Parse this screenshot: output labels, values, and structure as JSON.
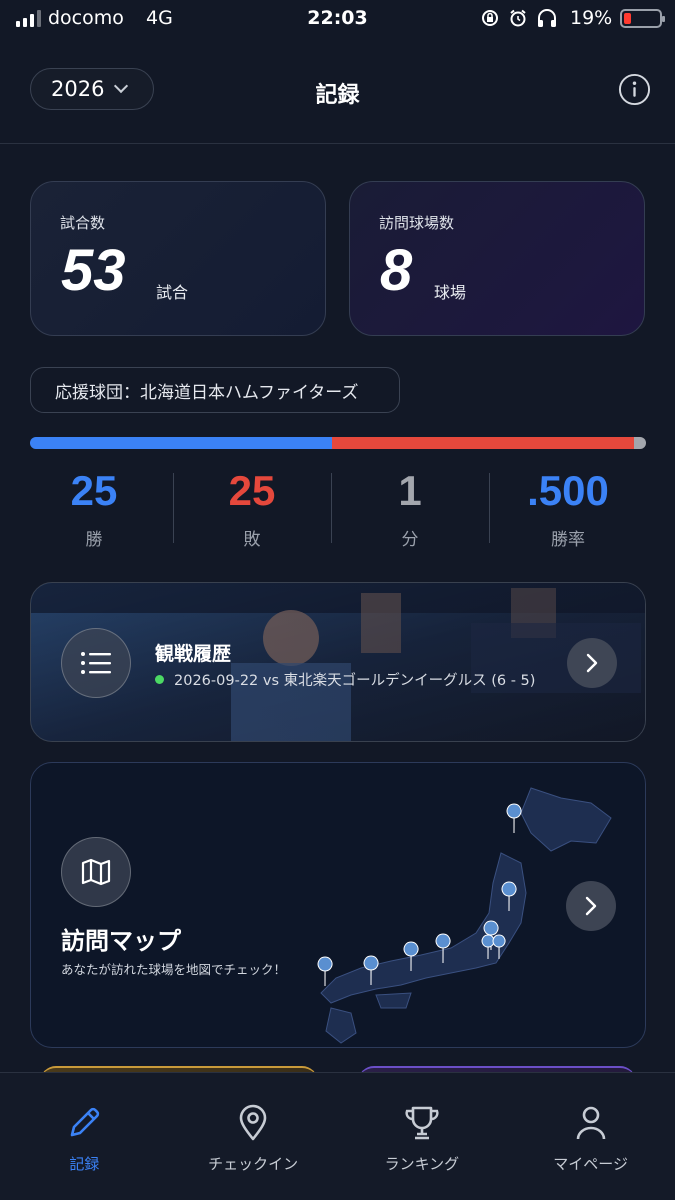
{
  "status_bar": {
    "carrier": "docomo",
    "network": "4G",
    "time": "22:03",
    "battery_percent": "19%",
    "icons": [
      "rotation-lock-icon",
      "alarm-icon",
      "headphones-icon"
    ]
  },
  "header": {
    "year": "2026",
    "title": "記録"
  },
  "stats": {
    "games_label": "試合数",
    "games_value": "53",
    "games_unit": "試合",
    "parks_label": "訪問球場数",
    "parks_value": "8",
    "parks_unit": "球場"
  },
  "team": {
    "label": "応援球団：北海道日本ハムファイターズ"
  },
  "record": {
    "wins": "25",
    "wins_label": "勝",
    "losses": "25",
    "losses_label": "敗",
    "draws": "1",
    "draws_label": "分",
    "win_rate": ".500",
    "win_rate_label": "勝率",
    "bar_fraction": {
      "wins": 0.49,
      "losses": 0.49,
      "draws": 0.02
    },
    "colors": {
      "wins": "#3b82f6",
      "losses": "#e5483c",
      "draws": "#a3a6ad"
    }
  },
  "history": {
    "title": "観戦履歴",
    "latest": "2026-09-22 vs 東北楽天ゴールデンイーグルス (6 - 5)"
  },
  "visit_map": {
    "title": "訪問マップ",
    "subtitle": "あなたが訪れた球場を地図でチェック！"
  },
  "nav": {
    "items": [
      {
        "label": "記録",
        "icon": "pencil-icon",
        "active": true
      },
      {
        "label": "チェックイン",
        "icon": "location-pin-icon",
        "active": false
      },
      {
        "label": "ランキング",
        "icon": "trophy-icon",
        "active": false
      },
      {
        "label": "マイページ",
        "icon": "person-icon",
        "active": false
      }
    ]
  },
  "colors": {
    "accent": "#3b82f6",
    "loss": "#e5483c",
    "background": "#121826"
  }
}
